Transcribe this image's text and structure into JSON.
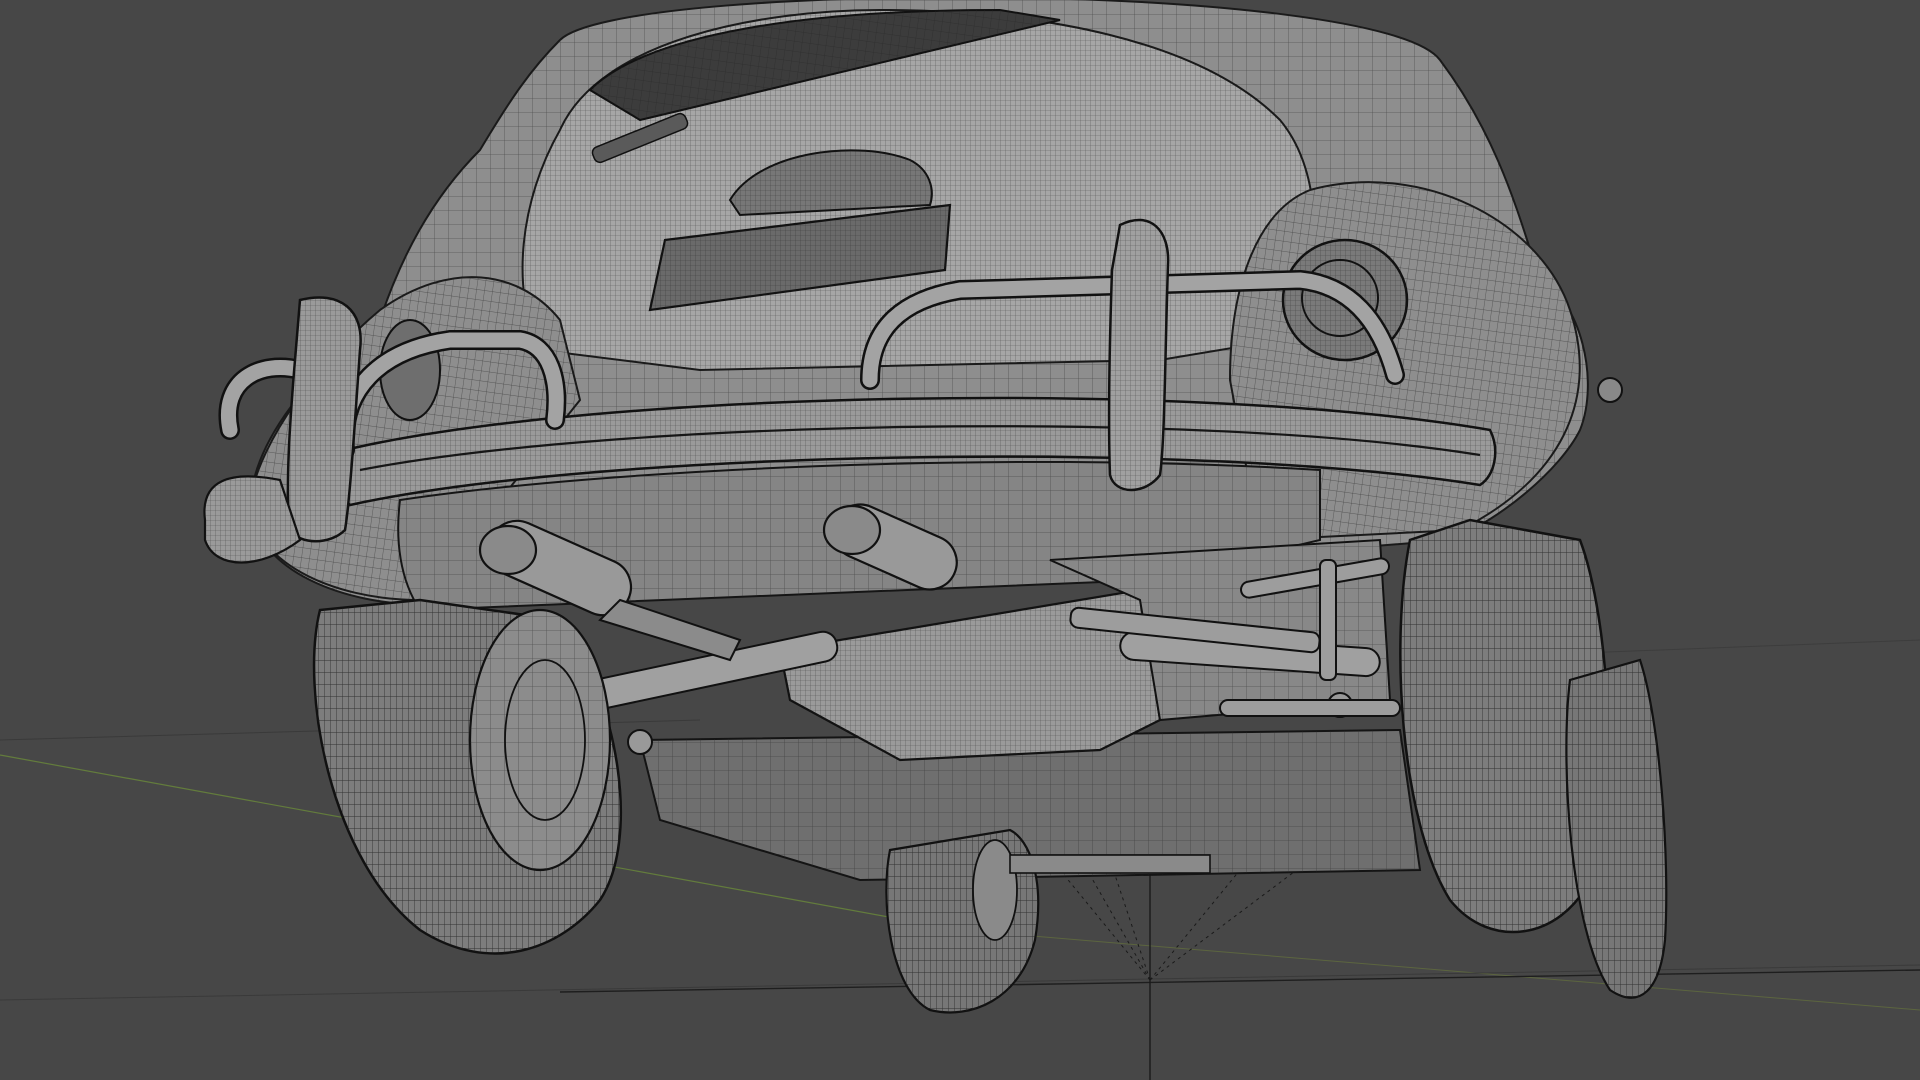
{
  "viewport": {
    "background": "#474747",
    "mode": "wireframe-overlay-solid",
    "object": "car-3d-model"
  },
  "colors": {
    "background": "#474747",
    "model_surface": "#8e8e8e",
    "wire": "#1f1f1f",
    "x_axis": "#9a4a4a",
    "y_axis": "#6a8a3a",
    "grid": "#3a3a3a"
  }
}
